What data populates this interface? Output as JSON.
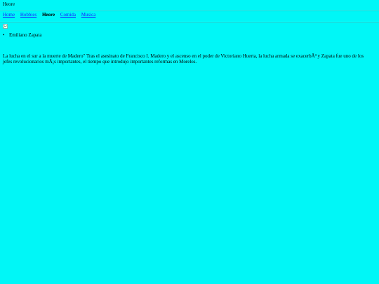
{
  "site": {
    "title": "Heore"
  },
  "nav": {
    "items": [
      {
        "label": "Home",
        "link": true
      },
      {
        "label": "Hobbies",
        "link": true
      },
      {
        "label": "Heore",
        "link": false
      },
      {
        "label": "Comida",
        "link": true
      },
      {
        "label": "Musica",
        "link": true
      }
    ]
  },
  "content": {
    "bullets": [
      "Emiliano Zapata"
    ],
    "paragraph": "La lucha en el sur a la muerte de Madero\" Tras el asesinato de Francisco I. Madero y el ascenso en el poder de Victoriano Huerta, la lucha armada se exacerbÃ³ y Zapata fue uno de los jefes revolucionarios mÃ¡s importantes, el tiempo que introdujo importantes reformas en Morelos."
  },
  "colors": {
    "background": "#00f7f7",
    "link": "#1a1aff"
  },
  "icons": {
    "image_placeholder": "broken-image-icon"
  }
}
